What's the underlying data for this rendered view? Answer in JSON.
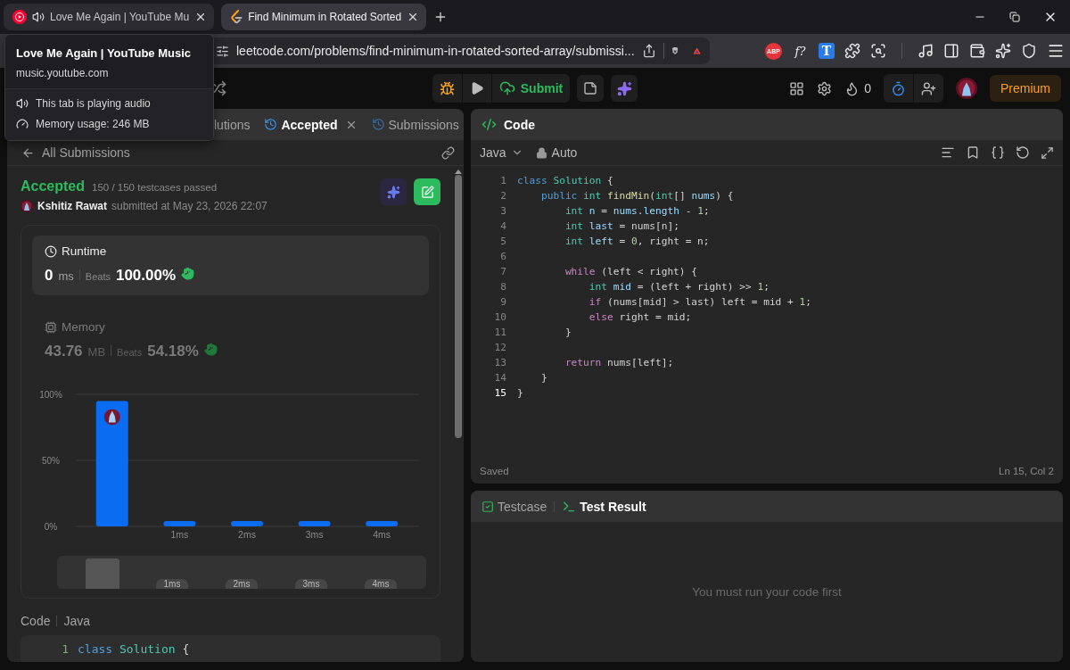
{
  "browser": {
    "tabs": [
      {
        "kind": "music",
        "title": "Love Me Again | YouTube Mu",
        "audio": true,
        "selected": false
      },
      {
        "kind": "leetcode",
        "title": "Find Minimum in Rotated Sorted",
        "audio": false,
        "selected": true
      }
    ],
    "url": "leetcode.com/problems/find-minimum-in-rotated-sorted-array/submissi...",
    "extensions": [
      {
        "kind": "abp",
        "label": "ABP"
      },
      {
        "kind": "formula",
        "label": "f?"
      },
      {
        "kind": "translate",
        "label": "T"
      },
      {
        "kind": "puzzle"
      },
      {
        "kind": "search-window"
      }
    ],
    "toolbar": [
      {
        "kind": "music"
      },
      {
        "kind": "sidebar"
      },
      {
        "kind": "wallet"
      },
      {
        "kind": "leo"
      },
      {
        "kind": "vpn"
      },
      {
        "kind": "menu"
      }
    ],
    "tooltip": {
      "title": "Love Me Again | YouTube Music",
      "host": "music.youtube.com",
      "lines": [
        {
          "kind": "audio",
          "text": "This tab is playing audio"
        },
        {
          "kind": "memory",
          "text": "Memory usage: 246 MB"
        }
      ]
    }
  },
  "nav": {
    "submit": "Submit",
    "streak": "0",
    "premium": "Premium"
  },
  "left_panel": {
    "tabs": [
      {
        "kind": "plain",
        "label": "lutions",
        "selected": false,
        "closable": false
      },
      {
        "kind": "history",
        "label": "Accepted",
        "selected": true,
        "closable": true
      },
      {
        "kind": "history",
        "label": "Submissions",
        "selected": false,
        "closable": false
      }
    ],
    "back": "All Submissions",
    "result": {
      "status": "Accepted",
      "testcases": "150 / 150 testcases passed",
      "user": "Kshitiz Rawat",
      "submitted": "submitted at May 23, 2026 22:07"
    },
    "stats": [
      {
        "kind": "runtime",
        "title": "Runtime",
        "value": "0",
        "unit": "ms",
        "beats_label": "Beats",
        "beats": "100.00%",
        "selected": true
      },
      {
        "kind": "memory",
        "title": "Memory",
        "value": "43.76",
        "unit": "MB",
        "beats_label": "Beats",
        "beats": "54.18%",
        "selected": false
      }
    ],
    "chart_data": {
      "type": "bar",
      "categories": [
        null,
        "1ms",
        "2ms",
        "3ms",
        "4ms"
      ],
      "values": [
        95,
        4,
        4,
        4,
        4
      ],
      "ylim": [
        0,
        100
      ],
      "yticks": [
        {
          "value": 0,
          "label": "0%"
        },
        {
          "value": 50,
          "label": "50%"
        },
        {
          "value": 100,
          "label": "100%"
        }
      ]
    },
    "navigator_labels": [
      "1ms",
      "2ms",
      "3ms",
      "4ms"
    ],
    "code_label": "Code",
    "code_language": "Java",
    "code_preview": [
      {
        "number": "1",
        "tokens": [
          {
            "text": "class ",
            "kind": "keyword"
          },
          {
            "text": "Solution",
            "kind": "type"
          },
          {
            "text": " {",
            "kind": "plain"
          }
        ]
      }
    ]
  },
  "editor": {
    "title": "Code",
    "language": "Java",
    "mode": "Auto",
    "lines": [
      {
        "number": "1",
        "current": false,
        "tokens": [
          {
            "text": "class ",
            "kind": "keyword"
          },
          {
            "text": "Solution",
            "kind": "type"
          },
          {
            "text": " {",
            "kind": "plain"
          }
        ]
      },
      {
        "number": "2",
        "current": false,
        "tokens": [
          {
            "text": "    public ",
            "kind": "keyword"
          },
          {
            "text": "int ",
            "kind": "type"
          },
          {
            "text": "findMin",
            "kind": "function"
          },
          {
            "text": "(",
            "kind": "plain"
          },
          {
            "text": "int",
            "kind": "type"
          },
          {
            "text": "[] ",
            "kind": "plain"
          },
          {
            "text": "nums",
            "kind": "variable"
          },
          {
            "text": ") {",
            "kind": "plain"
          }
        ]
      },
      {
        "number": "3",
        "current": false,
        "tokens": [
          {
            "text": "        int ",
            "kind": "type"
          },
          {
            "text": "n",
            "kind": "variable"
          },
          {
            "text": " = ",
            "kind": "plain"
          },
          {
            "text": "nums",
            "kind": "variable"
          },
          {
            "text": ".",
            "kind": "plain"
          },
          {
            "text": "length",
            "kind": "variable"
          },
          {
            "text": " - ",
            "kind": "plain"
          },
          {
            "text": "1",
            "kind": "number"
          },
          {
            "text": ";",
            "kind": "plain"
          }
        ]
      },
      {
        "number": "4",
        "current": false,
        "tokens": [
          {
            "text": "        int ",
            "kind": "type"
          },
          {
            "text": "last",
            "kind": "variable"
          },
          {
            "text": " = nums[n];",
            "kind": "plain"
          }
        ]
      },
      {
        "number": "5",
        "current": false,
        "tokens": [
          {
            "text": "        int ",
            "kind": "type"
          },
          {
            "text": "left",
            "kind": "variable"
          },
          {
            "text": " = ",
            "kind": "plain"
          },
          {
            "text": "0",
            "kind": "number"
          },
          {
            "text": ", right = n;",
            "kind": "plain"
          }
        ]
      },
      {
        "number": "6",
        "current": false
      },
      {
        "number": "7",
        "current": false,
        "tokens": [
          {
            "text": "        while",
            "kind": "control"
          },
          {
            "text": " (left < right) {",
            "kind": "plain"
          }
        ]
      },
      {
        "number": "8",
        "current": false,
        "tokens": [
          {
            "text": "            int ",
            "kind": "type"
          },
          {
            "text": "mid",
            "kind": "variable"
          },
          {
            "text": " = (left + right) >> ",
            "kind": "plain"
          },
          {
            "text": "1",
            "kind": "number"
          },
          {
            "text": ";",
            "kind": "plain"
          }
        ]
      },
      {
        "number": "9",
        "current": false,
        "tokens": [
          {
            "text": "            if",
            "kind": "control"
          },
          {
            "text": " (nums[mid] > last) left = mid + ",
            "kind": "plain"
          },
          {
            "text": "1",
            "kind": "number"
          },
          {
            "text": ";",
            "kind": "plain"
          }
        ]
      },
      {
        "number": "10",
        "current": false,
        "tokens": [
          {
            "text": "            else",
            "kind": "control"
          },
          {
            "text": " right = mid;",
            "kind": "plain"
          }
        ]
      },
      {
        "number": "11",
        "current": false,
        "tokens": [
          {
            "text": "        }",
            "kind": "plain"
          }
        ]
      },
      {
        "number": "12",
        "current": false
      },
      {
        "number": "13",
        "current": false,
        "tokens": [
          {
            "text": "        return",
            "kind": "control"
          },
          {
            "text": " nums[left];",
            "kind": "plain"
          }
        ]
      },
      {
        "number": "14",
        "current": false,
        "tokens": [
          {
            "text": "    }",
            "kind": "plain"
          }
        ]
      },
      {
        "number": "15",
        "current": true,
        "tokens": [
          {
            "text": "}",
            "kind": "plain"
          }
        ]
      }
    ],
    "status": "Saved",
    "position": "Ln 15, Col 2"
  },
  "bottom_panel": {
    "tabs": [
      {
        "kind": "check",
        "label": "Testcase",
        "selected": false
      },
      {
        "kind": "terminal",
        "label": "Test Result",
        "selected": true
      }
    ],
    "message": "You must run your code first"
  }
}
